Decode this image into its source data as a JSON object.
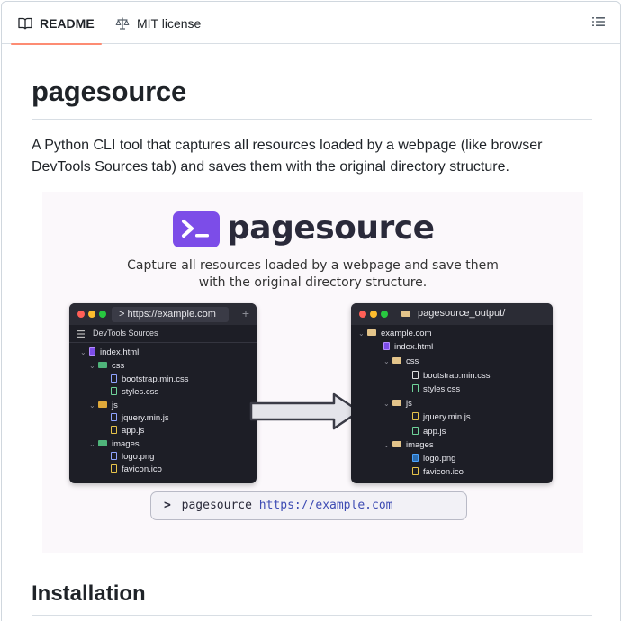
{
  "tabs": [
    {
      "label": "README",
      "icon": "book-icon",
      "active": true
    },
    {
      "label": "MIT license",
      "icon": "scale-icon",
      "active": false
    }
  ],
  "toc_icon": "list-unordered-icon",
  "readme": {
    "title": "pagesource",
    "description": "A Python CLI tool that captures all resources loaded by a webpage (like browser DevTools Sources tab) and saves them with the original directory structure.",
    "section_heading": "Installation"
  },
  "hero": {
    "brand": "pagesource",
    "tagline_line1": "Capture all resources loaded by a webpage and save them",
    "tagline_line2": "with the original directory structure.",
    "left_window": {
      "url": "> https://example.com",
      "panel_title": "DevTools Sources",
      "tree": [
        "index.html",
        "css",
        "bootstrap.min.css",
        "styles.css",
        "js",
        "jquery.min.js",
        "app.js",
        "images",
        "logo.png",
        "favicon.ico"
      ]
    },
    "right_window": {
      "title": "pagesource_output/",
      "tree": [
        "example.com",
        "index.html",
        "css",
        "bootstrap.min.css",
        "styles.css",
        "js",
        "jquery.min.js",
        "app.js",
        "images",
        "logo.png",
        "favicon.ico"
      ]
    },
    "command": {
      "prompt": ">",
      "program": "pagesource",
      "arg": "https://example.com"
    }
  },
  "colors": {
    "accent_underline": "#fd8c73",
    "logo_purple": "#7c4de8",
    "window_bg": "#1d1e26"
  }
}
